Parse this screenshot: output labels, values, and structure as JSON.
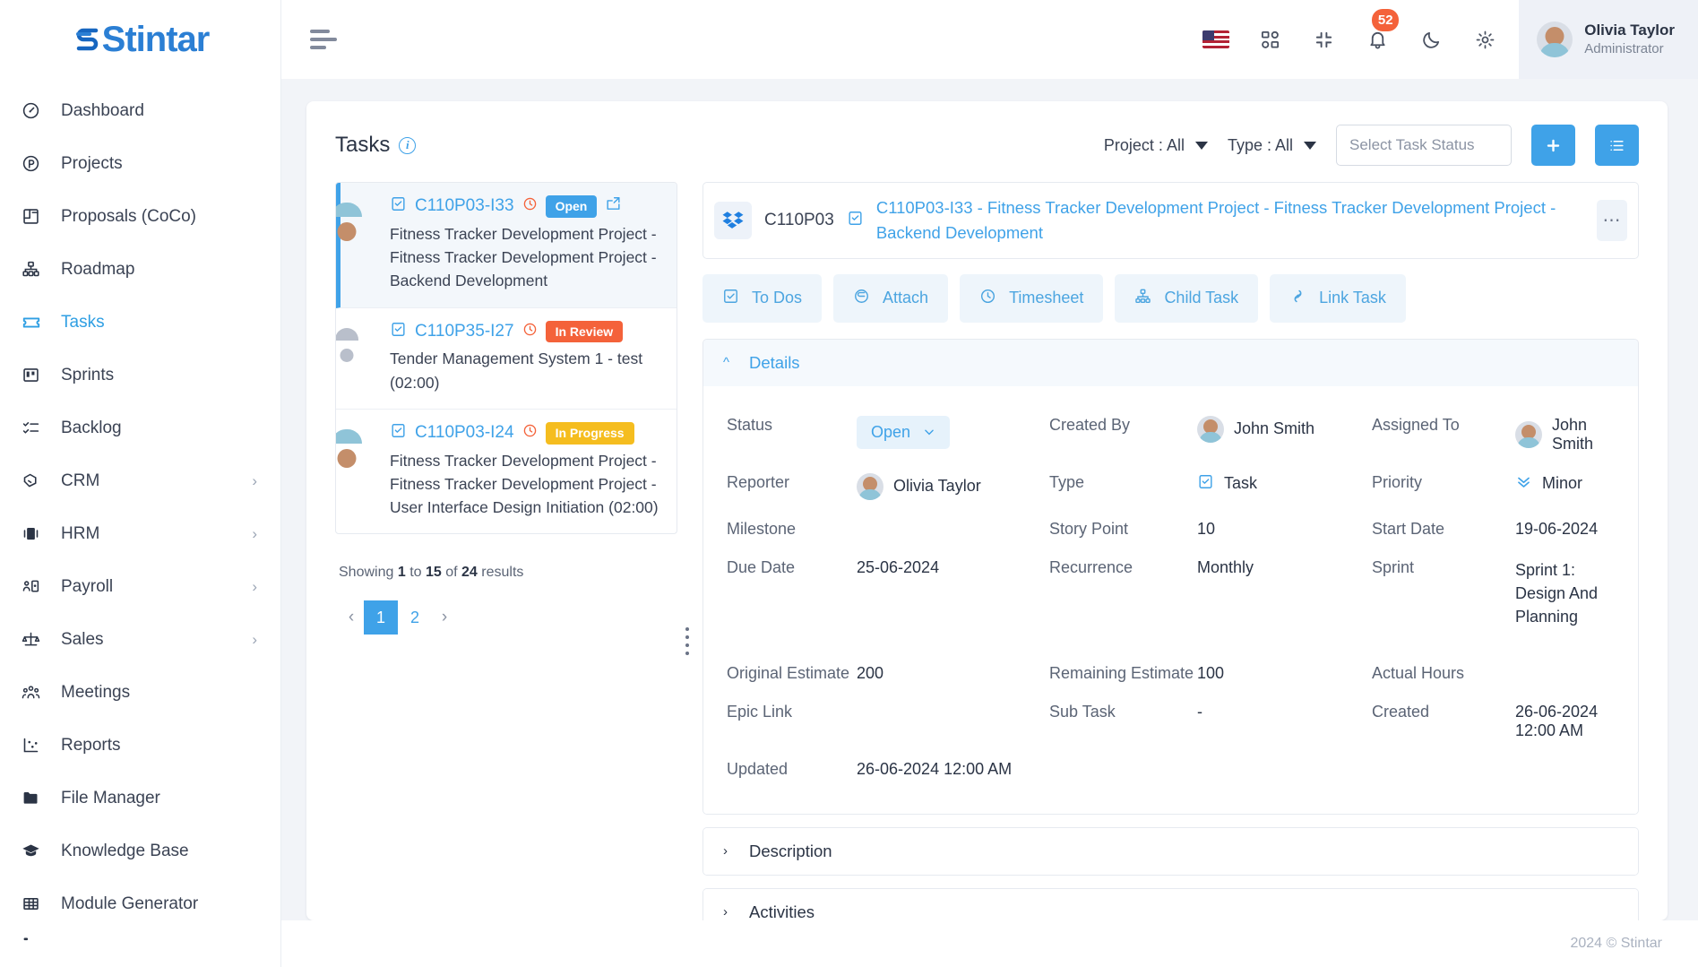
{
  "brand": {
    "name": "Stintar",
    "accent": "#3fa2e8"
  },
  "sidebar": {
    "items": [
      {
        "label": "Dashboard",
        "icon": "gauge-icon",
        "active": false,
        "expandable": false
      },
      {
        "label": "Projects",
        "icon": "circle-p-icon",
        "active": false,
        "expandable": false
      },
      {
        "label": "Proposals (CoCo)",
        "icon": "layout-icon",
        "active": false,
        "expandable": false
      },
      {
        "label": "Roadmap",
        "icon": "hierarchy-icon",
        "active": false,
        "expandable": false
      },
      {
        "label": "Tasks",
        "icon": "ticket-icon",
        "active": true,
        "expandable": false
      },
      {
        "label": "Sprints",
        "icon": "board-icon",
        "active": false,
        "expandable": false
      },
      {
        "label": "Backlog",
        "icon": "checklist-icon",
        "active": false,
        "expandable": false
      },
      {
        "label": "CRM",
        "icon": "handshake-icon",
        "active": false,
        "expandable": true
      },
      {
        "label": "HRM",
        "icon": "id-card-icon",
        "active": false,
        "expandable": true
      },
      {
        "label": "Payroll",
        "icon": "person-card-icon",
        "active": false,
        "expandable": true
      },
      {
        "label": "Sales",
        "icon": "scales-icon",
        "active": false,
        "expandable": true
      },
      {
        "label": "Meetings",
        "icon": "people-icon",
        "active": false,
        "expandable": false
      },
      {
        "label": "Reports",
        "icon": "chart-dots-icon",
        "active": false,
        "expandable": false
      },
      {
        "label": "File Manager",
        "icon": "folder-icon",
        "active": false,
        "expandable": false
      },
      {
        "label": "Knowledge Base",
        "icon": "graduation-cap-icon",
        "active": false,
        "expandable": false
      },
      {
        "label": "Module Generator",
        "icon": "grid-table-icon",
        "active": false,
        "expandable": false
      }
    ]
  },
  "topbar": {
    "menu_icon": "hamburger-icon",
    "language_flag": "us-flag-icon",
    "apps_icon": "apps-grid-icon",
    "fullscreen_icon": "compress-icon",
    "notifications_icon": "bell-icon",
    "notifications_count": "52",
    "theme_icon": "moon-icon",
    "settings_icon": "gear-icon",
    "user": {
      "name": "Olivia Taylor",
      "role": "Administrator"
    }
  },
  "page": {
    "title": "Tasks",
    "info_icon": "info-icon",
    "filters": [
      {
        "label": "Project : All"
      },
      {
        "label": "Type : All"
      }
    ],
    "status_search": {
      "value": "",
      "placeholder": "Select Task Status"
    },
    "add_button": "+",
    "list_button": "≡"
  },
  "task_list": {
    "items": [
      {
        "code": "C110P03-I33",
        "status": "Open",
        "status_kind": "open",
        "title": "Fitness Tracker Development Project - Fitness Tracker Development Project - Backend Development",
        "selected": true,
        "avatar": "man",
        "has_share_icon": true
      },
      {
        "code": "C110P35-I27",
        "status": "In Review",
        "status_kind": "review",
        "title": "Tender Management System 1 - test (02:00)",
        "selected": false,
        "avatar": "grey",
        "has_share_icon": false
      },
      {
        "code": "C110P03-I24",
        "status": "In Progress",
        "status_kind": "progress",
        "title": "Fitness Tracker Development Project - Fitness Tracker Development Project - User Interface Design Initiation (02:00)",
        "selected": false,
        "avatar": "man",
        "has_share_icon": false
      }
    ],
    "showing_prefix": "Showing",
    "showing_from": "1",
    "showing_mid": "to",
    "showing_to": "15",
    "showing_of": "of",
    "showing_total": "24",
    "showing_suffix": "results",
    "pagination": {
      "prev": "‹",
      "pages": [
        "1",
        "2"
      ],
      "current": "1",
      "next": "›"
    }
  },
  "detail": {
    "project_icon": "dropbox-icon",
    "project_code": "C110P03",
    "task_type_icon": "task-clipboard-icon",
    "title": "C110P03-I33 - Fitness Tracker Development Project - Fitness Tracker Development Project - Backend Development",
    "kebab": "⋯",
    "tabs": [
      {
        "label": "To Dos",
        "icon": "checkbox-icon"
      },
      {
        "label": "Attach",
        "icon": "paperclip-icon"
      },
      {
        "label": "Timesheet",
        "icon": "clock-icon"
      },
      {
        "label": "Child Task",
        "icon": "hierarchy-icon"
      },
      {
        "label": "Link Task",
        "icon": "link-icon"
      }
    ],
    "sections": {
      "details": {
        "label": "Details",
        "expanded": true
      },
      "description": {
        "label": "Description",
        "expanded": false
      },
      "activities": {
        "label": "Activities",
        "expanded": false
      }
    },
    "fields": {
      "status": {
        "label": "Status",
        "value": "Open"
      },
      "created_by": {
        "label": "Created By",
        "value": "John Smith"
      },
      "assigned_to": {
        "label": "Assigned To",
        "value": "John Smith"
      },
      "reporter": {
        "label": "Reporter",
        "value": "Olivia Taylor"
      },
      "type": {
        "label": "Type",
        "value": "Task"
      },
      "priority": {
        "label": "Priority",
        "value": "Minor"
      },
      "milestone": {
        "label": "Milestone",
        "value": ""
      },
      "story_point": {
        "label": "Story Point",
        "value": "10"
      },
      "start_date": {
        "label": "Start Date",
        "value": "19-06-2024"
      },
      "due_date": {
        "label": "Due Date",
        "value": "25-06-2024"
      },
      "recurrence": {
        "label": "Recurrence",
        "value": "Monthly"
      },
      "sprint": {
        "label": "Sprint",
        "value": "Sprint 1: Design And Planning"
      },
      "original_estimate": {
        "label": "Original Estimate",
        "value": "200"
      },
      "remaining_estimate": {
        "label": "Remaining Estimate",
        "value": "100"
      },
      "actual_hours": {
        "label": "Actual Hours",
        "value": ""
      },
      "epic_link": {
        "label": "Epic Link",
        "value": ""
      },
      "sub_task": {
        "label": "Sub Task",
        "value": "-"
      },
      "created": {
        "label": "Created",
        "value": "26-06-2024 12:00 AM"
      },
      "updated": {
        "label": "Updated",
        "value": "26-06-2024 12:00 AM"
      }
    }
  },
  "footer": {
    "copyright": "2024 © Stintar"
  }
}
